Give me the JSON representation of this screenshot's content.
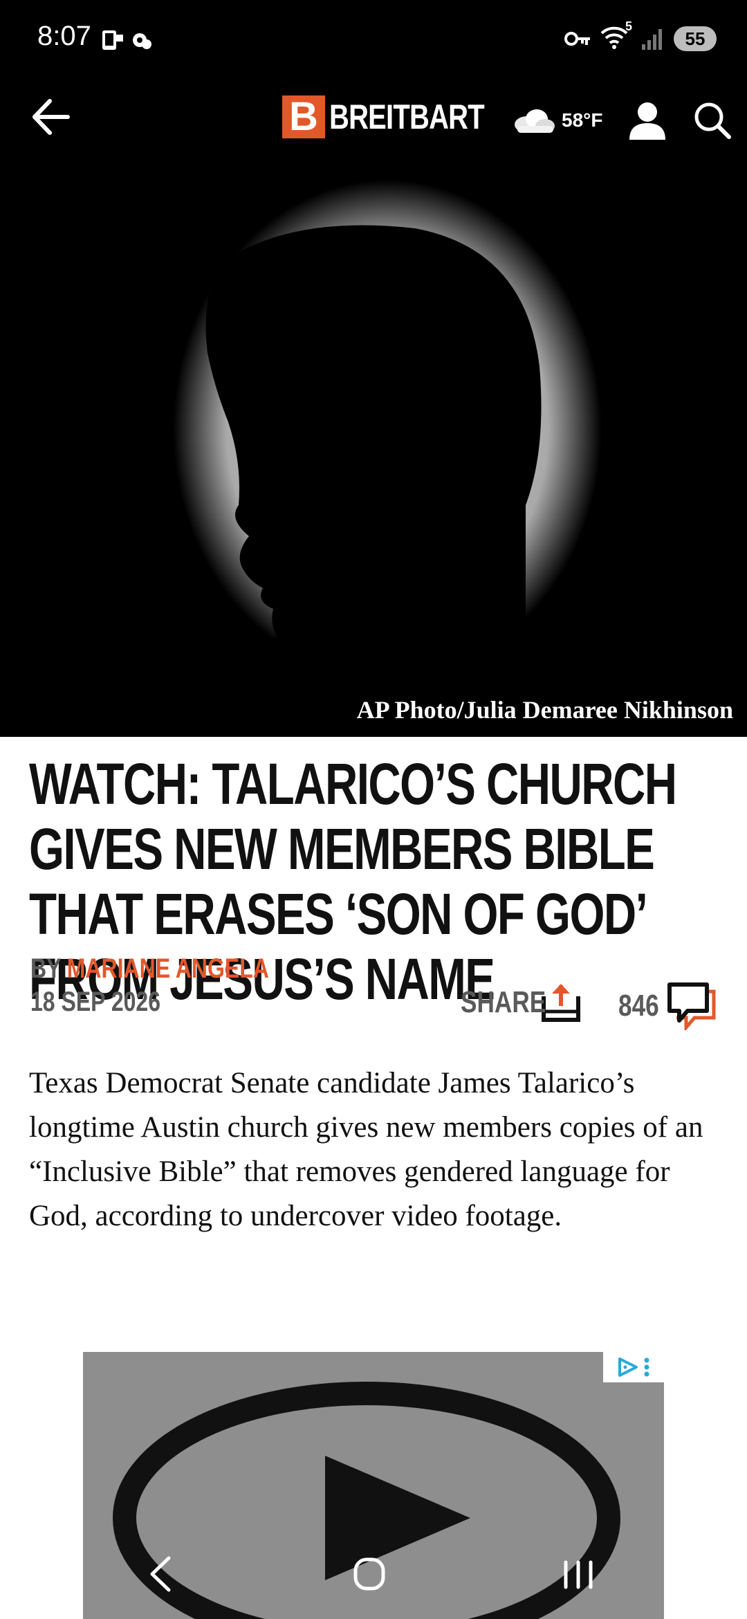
{
  "status_bar": {
    "time": "8:07",
    "battery": "55",
    "network_badge": "5"
  },
  "header": {
    "logo_letter": "B",
    "logo_text": "BREITBART",
    "weather_temp": "58°F",
    "icons": [
      "back-arrow-icon",
      "cloud-icon",
      "user-icon",
      "search-icon"
    ]
  },
  "hero": {
    "caption": "AP Photo/Julia Demaree Nikhinson"
  },
  "article": {
    "headline": "WATCH: Talarico’s Church Gives New Members Bible That Erases ‘Son of God’ from Jesus’s Name",
    "byline_prefix": "BY ",
    "author": "MARIANE ANGELA",
    "date": "18 SEP 2026",
    "share_label": "SHARE",
    "comment_count": "846",
    "body": "Texas Democrat Senate candidate James Talarico’s longtime Austin church gives new members copies of an “Inclusive Bible” that removes gendered language for God, according to undercover video footage."
  },
  "colors": {
    "accent": "#e2582b",
    "meta_gray": "#5a5a5a",
    "header_bg": "#000000"
  }
}
